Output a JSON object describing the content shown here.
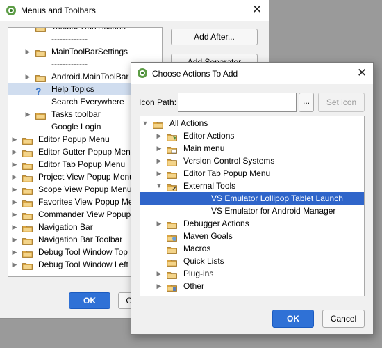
{
  "menus_dialog": {
    "title": "Menus and Toolbars",
    "tree_rows": [
      {
        "label": "Toolbar Run Actions",
        "type": "folder",
        "level": 2,
        "arrow": ""
      },
      {
        "label": "-------------",
        "type": "separator",
        "level": 2,
        "arrow": ""
      },
      {
        "label": "MainToolBarSettings",
        "type": "folder",
        "level": 2,
        "arrow": "right"
      },
      {
        "label": "-------------",
        "type": "separator",
        "level": 2,
        "arrow": ""
      },
      {
        "label": "Android.MainToolBar",
        "type": "folder",
        "level": 2,
        "arrow": "right"
      },
      {
        "label": "Help Topics",
        "type": "help",
        "level": 2,
        "arrow": "",
        "selected": true
      },
      {
        "label": "Search Everywhere",
        "type": "plain",
        "level": 2,
        "arrow": ""
      },
      {
        "label": "Tasks toolbar",
        "type": "folder",
        "level": 2,
        "arrow": "right"
      },
      {
        "label": "Google Login",
        "type": "plain",
        "level": 2,
        "arrow": ""
      },
      {
        "label": "Editor Popup Menu",
        "type": "folder",
        "level": 1,
        "arrow": "right"
      },
      {
        "label": "Editor Gutter Popup Menu",
        "type": "folder",
        "level": 1,
        "arrow": "right"
      },
      {
        "label": "Editor Tab Popup Menu",
        "type": "folder",
        "level": 1,
        "arrow": "right"
      },
      {
        "label": "Project View Popup Menu",
        "type": "folder",
        "level": 1,
        "arrow": "right"
      },
      {
        "label": "Scope View Popup Menu",
        "type": "folder",
        "level": 1,
        "arrow": "right"
      },
      {
        "label": "Favorites View Popup Menu",
        "type": "folder",
        "level": 1,
        "arrow": "right"
      },
      {
        "label": "Commander View Popup Menu",
        "type": "folder",
        "level": 1,
        "arrow": "right"
      },
      {
        "label": "Navigation Bar",
        "type": "folder",
        "level": 1,
        "arrow": "right"
      },
      {
        "label": "Navigation Bar Toolbar",
        "type": "folder",
        "level": 1,
        "arrow": "right"
      },
      {
        "label": "Debug Tool Window Top",
        "type": "folder",
        "level": 1,
        "arrow": "right"
      },
      {
        "label": "Debug Tool Window Left",
        "type": "folder",
        "level": 1,
        "arrow": "right"
      }
    ],
    "add_after_label": "Add After...",
    "add_separator_label": "Add Separator",
    "ok_label": "OK",
    "cancel_label": "Cancel"
  },
  "actions_dialog": {
    "title": "Choose Actions To Add",
    "icon_path_label": "Icon Path:",
    "icon_path_value": "",
    "browse_label": "...",
    "set_icon_label": "Set icon",
    "tree_rows": [
      {
        "label": "All Actions",
        "type": "folder",
        "level": 0,
        "arrow": "down"
      },
      {
        "label": "Editor Actions",
        "type": "editor",
        "level": 1,
        "arrow": "right"
      },
      {
        "label": "Main menu",
        "type": "menu",
        "level": 1,
        "arrow": "right"
      },
      {
        "label": "Version Control Systems",
        "type": "folder",
        "level": 1,
        "arrow": "right"
      },
      {
        "label": "Editor Tab Popup Menu",
        "type": "folder",
        "level": 1,
        "arrow": "right"
      },
      {
        "label": "External Tools",
        "type": "tools",
        "level": 1,
        "arrow": "down"
      },
      {
        "label": "VS Emulator Lollipop Tablet Launch",
        "type": "plain",
        "level": 2,
        "arrow": "",
        "selected": true
      },
      {
        "label": "VS Emulator for Android Manager",
        "type": "plain",
        "level": 2,
        "arrow": ""
      },
      {
        "label": "Debugger Actions",
        "type": "folder",
        "level": 1,
        "arrow": "right"
      },
      {
        "label": "Maven Goals",
        "type": "maven",
        "level": 1,
        "arrow": ""
      },
      {
        "label": "Macros",
        "type": "folder",
        "level": 1,
        "arrow": ""
      },
      {
        "label": "Quick Lists",
        "type": "folder",
        "level": 1,
        "arrow": ""
      },
      {
        "label": "Plug-ins",
        "type": "folder",
        "level": 1,
        "arrow": "right"
      },
      {
        "label": "Other",
        "type": "other",
        "level": 1,
        "arrow": "right"
      }
    ],
    "ok_label": "OK",
    "cancel_label": "Cancel"
  },
  "colors": {
    "accent": "#2f65ca",
    "folder": "#d9a441",
    "help": "#3e78c9"
  },
  "icons": [
    "android-studio-icon",
    "close-icon",
    "folder-icon",
    "help-icon",
    "chevron-right-icon",
    "chevron-down-icon"
  ]
}
